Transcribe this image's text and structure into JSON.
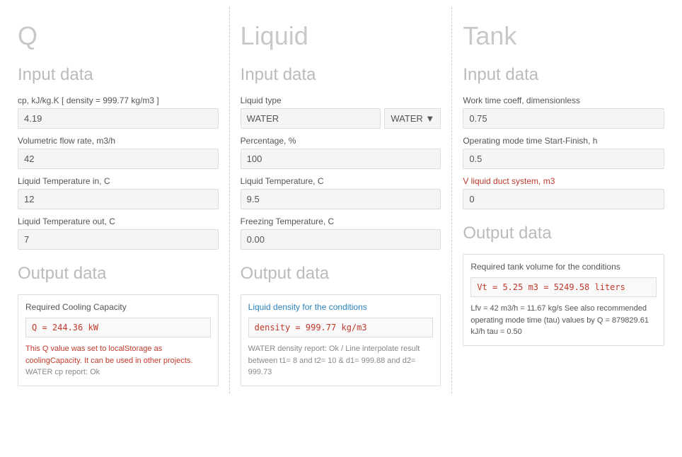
{
  "columns": [
    {
      "id": "q",
      "title": "Q",
      "inputSection": {
        "title": "Input data",
        "fields": [
          {
            "id": "cp",
            "label": "cp, kJ/kg.K [ density = 999.77 kg/m3 ]",
            "value": "4.19",
            "labelOrange": false
          },
          {
            "id": "volumetric_flow_rate",
            "label": "Volumetric flow rate, m3/h",
            "value": "42",
            "labelOrange": false
          },
          {
            "id": "temp_in",
            "label": "Liquid Temperature in, C",
            "value": "12",
            "labelOrange": false
          },
          {
            "id": "temp_out",
            "label": "Liquid Temperature out, C",
            "value": "7",
            "labelOrange": false
          }
        ]
      },
      "outputSection": {
        "title": "Output data",
        "box": {
          "title": "Required Cooling Capacity",
          "titleBlue": false,
          "value": "Q = 244.36 kW",
          "notes": [
            {
              "text": "This Q value was set to localStorage as coolingCapacity. It can be used in other projects.",
              "style": "orange"
            },
            {
              "text": "WATER cp report: Ok",
              "style": "gray"
            }
          ]
        }
      }
    },
    {
      "id": "liquid",
      "title": "Liquid",
      "inputSection": {
        "title": "Input data",
        "fields": [
          {
            "id": "liquid_type",
            "label": "Liquid type",
            "value": "WATER",
            "hasDropdown": true,
            "dropdownValue": "WATER",
            "labelOrange": false
          },
          {
            "id": "percentage",
            "label": "Percentage, %",
            "value": "100",
            "labelOrange": false
          },
          {
            "id": "liquid_temp",
            "label": "Liquid Temperature, C",
            "value": "9.5",
            "labelOrange": false
          },
          {
            "id": "freezing_temp",
            "label": "Freezing Temperature, C",
            "value": "0.00",
            "labelOrange": false
          }
        ]
      },
      "outputSection": {
        "title": "Output data",
        "box": {
          "title": "Liquid density for the conditions",
          "titleBlue": true,
          "value": "density = 999.77 kg/m3",
          "notes": [
            {
              "text": "WATER density report: Ok / Line interpolate result between t1= 8 and t2= 10 & d1= 999.88 and d2= 999.73",
              "style": "gray"
            }
          ]
        }
      }
    },
    {
      "id": "tank",
      "title": "Tank",
      "inputSection": {
        "title": "Input data",
        "fields": [
          {
            "id": "work_time_coeff",
            "label": "Work time coeff, dimensionless",
            "value": "0.75",
            "labelOrange": false
          },
          {
            "id": "operating_mode_time",
            "label": "Operating mode time Start-Finish, h",
            "value": "0.5",
            "labelOrange": false
          },
          {
            "id": "v_liquid_duct",
            "label": "V liquid duct system, m3",
            "value": "0",
            "labelOrange": true
          }
        ]
      },
      "outputSection": {
        "title": "Output data",
        "box": {
          "title": "Required tank volume for the conditions",
          "titleBlue": false,
          "value": "Vt = 5.25 m3 = 5249.58 liters",
          "notes": [
            {
              "text": "Lfv = 42 m3/h = 11.67 kg/s See also recommended operating mode time (tau) values by Q = 879829.61 kJ/h tau = 0.50",
              "style": "dark"
            }
          ]
        }
      }
    }
  ]
}
